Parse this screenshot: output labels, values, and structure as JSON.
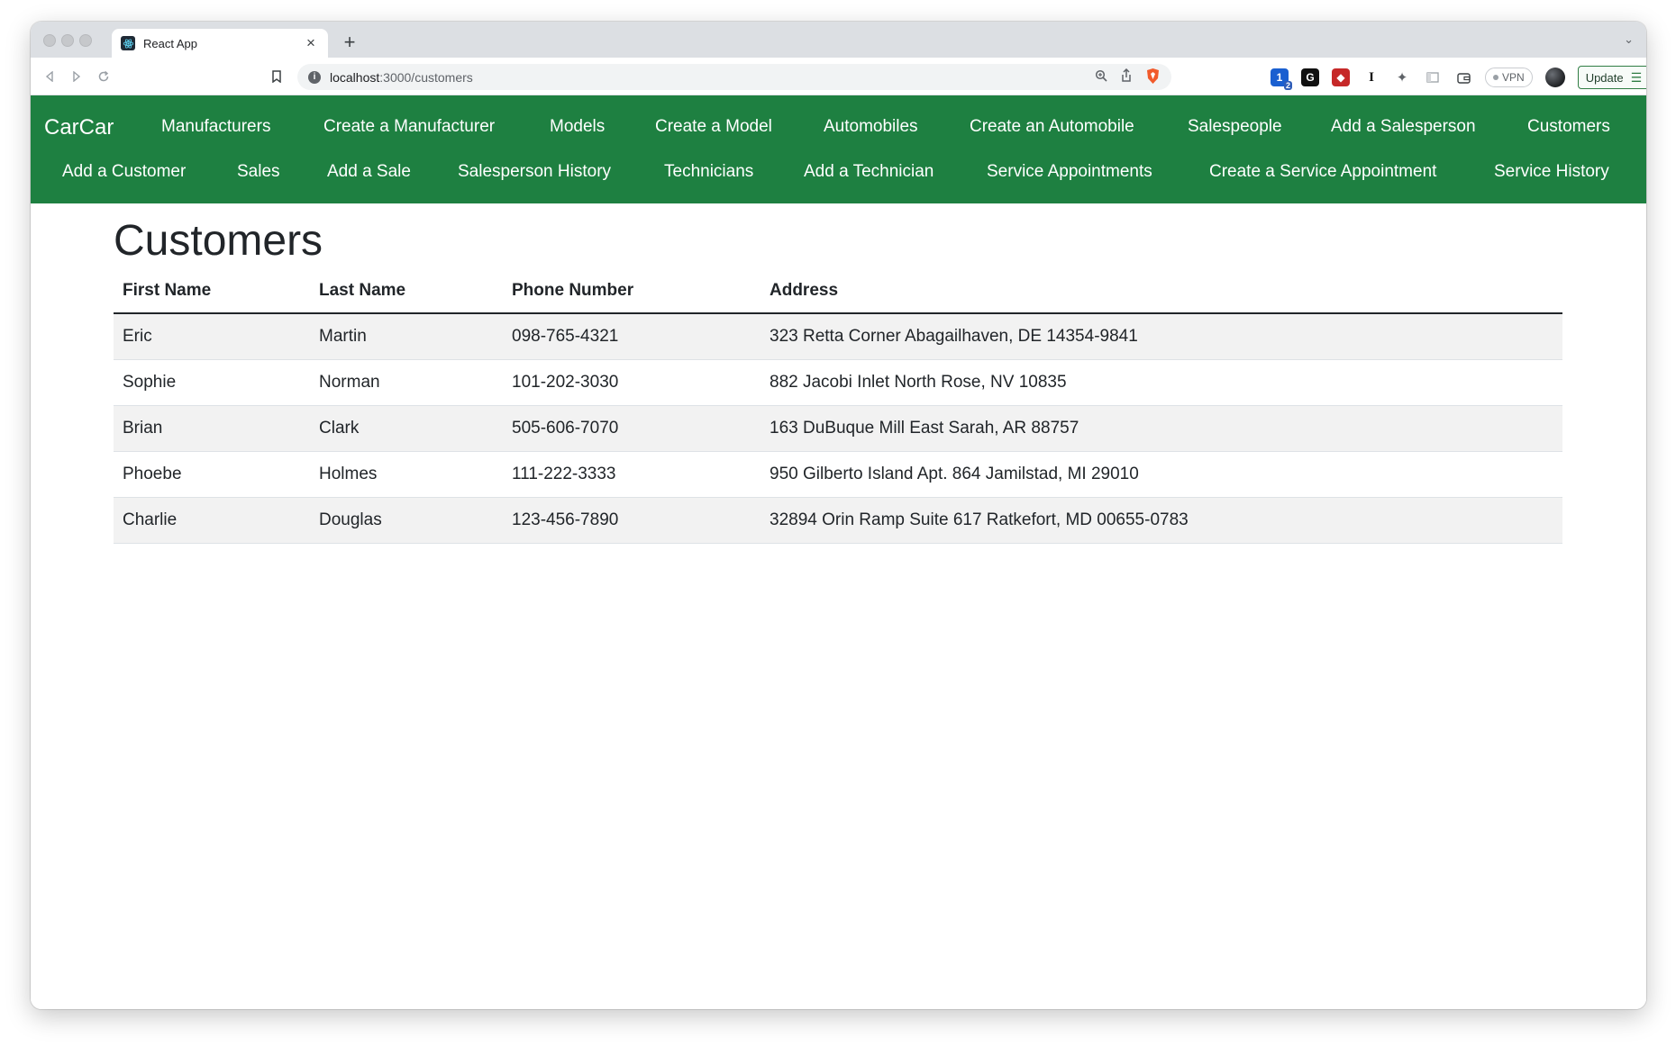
{
  "browser": {
    "tab_title": "React App",
    "url_host": "localhost",
    "url_path": ":3000/customers",
    "vpn_label": "VPN",
    "update_label": "Update",
    "ext_badge": "2"
  },
  "navbar": {
    "brand": "CarCar",
    "links": [
      "Manufacturers",
      "Create a Manufacturer",
      "Models",
      "Create a Model",
      "Automobiles",
      "Create an Automobile",
      "Salespeople",
      "Add a Salesperson",
      "Customers",
      "Add a Customer",
      "Sales",
      "Add a Sale",
      "Salesperson History",
      "Technicians",
      "Add a Technician",
      "Service Appointments",
      "Create a Service Appointment",
      "Service History"
    ]
  },
  "page": {
    "title": "Customers",
    "columns": [
      "First Name",
      "Last Name",
      "Phone Number",
      "Address"
    ],
    "rows": [
      [
        "Eric",
        "Martin",
        "098-765-4321",
        "323 Retta Corner Abagailhaven, DE 14354-9841"
      ],
      [
        "Sophie",
        "Norman",
        "101-202-3030",
        "882 Jacobi Inlet North Rose, NV 10835"
      ],
      [
        "Brian",
        "Clark",
        "505-606-7070",
        "163 DuBuque Mill East Sarah, AR 88757"
      ],
      [
        "Phoebe",
        "Holmes",
        "111-222-3333",
        "950 Gilberto Island Apt. 864 Jamilstad, MI 29010"
      ],
      [
        "Charlie",
        "Douglas",
        "123-456-7890",
        "32894 Orin Ramp Suite 617 Ratkefort, MD 00655-0783"
      ]
    ]
  },
  "colors": {
    "navbar": "#1e8041",
    "stripe": "#f2f2f2",
    "text": "#212529"
  }
}
